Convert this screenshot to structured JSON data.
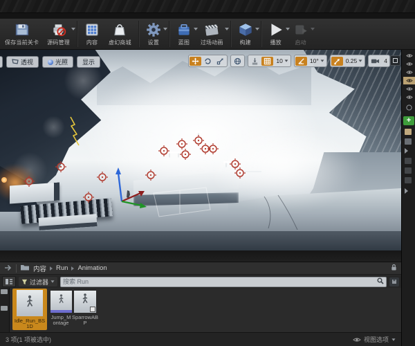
{
  "colors": {
    "accent_orange": "#c8811f",
    "selection_orange": "#c9881c",
    "montage_stripe": "#6e6ecf",
    "target_red": "#b03a2e",
    "gizmo_x": "#8e1f1f",
    "gizmo_y": "#1f9426",
    "gizmo_z": "#2e68d8"
  },
  "toolbar": {
    "items": [
      {
        "id": "save",
        "label": "保存当前关卡"
      },
      {
        "id": "source-control",
        "label": "源码管理"
      },
      {
        "id": "content",
        "label": "内容"
      },
      {
        "id": "marketplace",
        "label": "虚幻商城"
      },
      {
        "id": "settings",
        "label": "设置"
      },
      {
        "id": "blueprints",
        "label": "蓝图"
      },
      {
        "id": "cinematics",
        "label": "过场动画"
      },
      {
        "id": "build",
        "label": "构建"
      },
      {
        "id": "play",
        "label": "播放"
      },
      {
        "id": "launch",
        "label": "启动",
        "disabled": true
      }
    ]
  },
  "viewport": {
    "buttons": {
      "perspective": "透视",
      "lit": "光照",
      "show": "显示"
    },
    "snap": {
      "grid_value": "10",
      "angle_value": "10°",
      "scale_value": "0.25",
      "camera_speed": "4"
    }
  },
  "content_browser": {
    "breadcrumb": {
      "root": "内容",
      "folder": "Run",
      "subfolder": "Animation"
    },
    "filter_button": "过滤器",
    "search_placeholder": "搜索 Run",
    "assets": [
      {
        "name": "Idle_Run_BS1D",
        "type": "blendspace",
        "selected": true
      },
      {
        "name": "Jump_Montage",
        "type": "montage",
        "selected": false
      },
      {
        "name": "SparrowABP",
        "type": "anim-blueprint",
        "selected": false
      }
    ],
    "status_text": "3 项(1 项被选中)",
    "view_options_label": "视图选项"
  }
}
